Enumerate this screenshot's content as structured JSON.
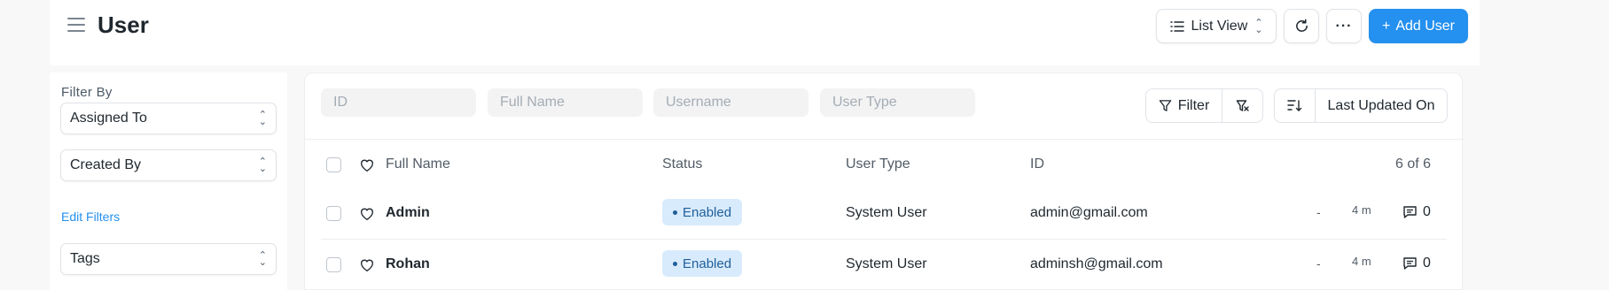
{
  "header": {
    "title": "User",
    "view_label": "List View",
    "more_label": "···",
    "add_label": "Add User",
    "add_prefix": "+"
  },
  "sidebar": {
    "filter_by": "Filter By",
    "selects": [
      "Assigned To",
      "Created By",
      "Tags"
    ],
    "edit_filters": "Edit Filters"
  },
  "filters": {
    "placeholders": [
      "ID",
      "Full Name",
      "Username",
      "User Type"
    ],
    "filter_label": "Filter",
    "sort_label": "Last Updated On"
  },
  "table": {
    "columns": {
      "name": "Full Name",
      "status": "Status",
      "type": "User Type",
      "id": "ID",
      "count": "6 of 6"
    },
    "rows": [
      {
        "name": "Admin",
        "status": "Enabled",
        "type": "System User",
        "id": "admin@gmail.com",
        "dash": "-",
        "time": "4 m",
        "comments": "0"
      },
      {
        "name": "Rohan",
        "status": "Enabled",
        "type": "System User",
        "id": "adminsh@gmail.com",
        "dash": "-",
        "time": "4 m",
        "comments": "0"
      }
    ]
  },
  "colors": {
    "accent": "#2490ef",
    "badge_bg": "#d8ebfc",
    "badge_text": "#1f5e99"
  }
}
